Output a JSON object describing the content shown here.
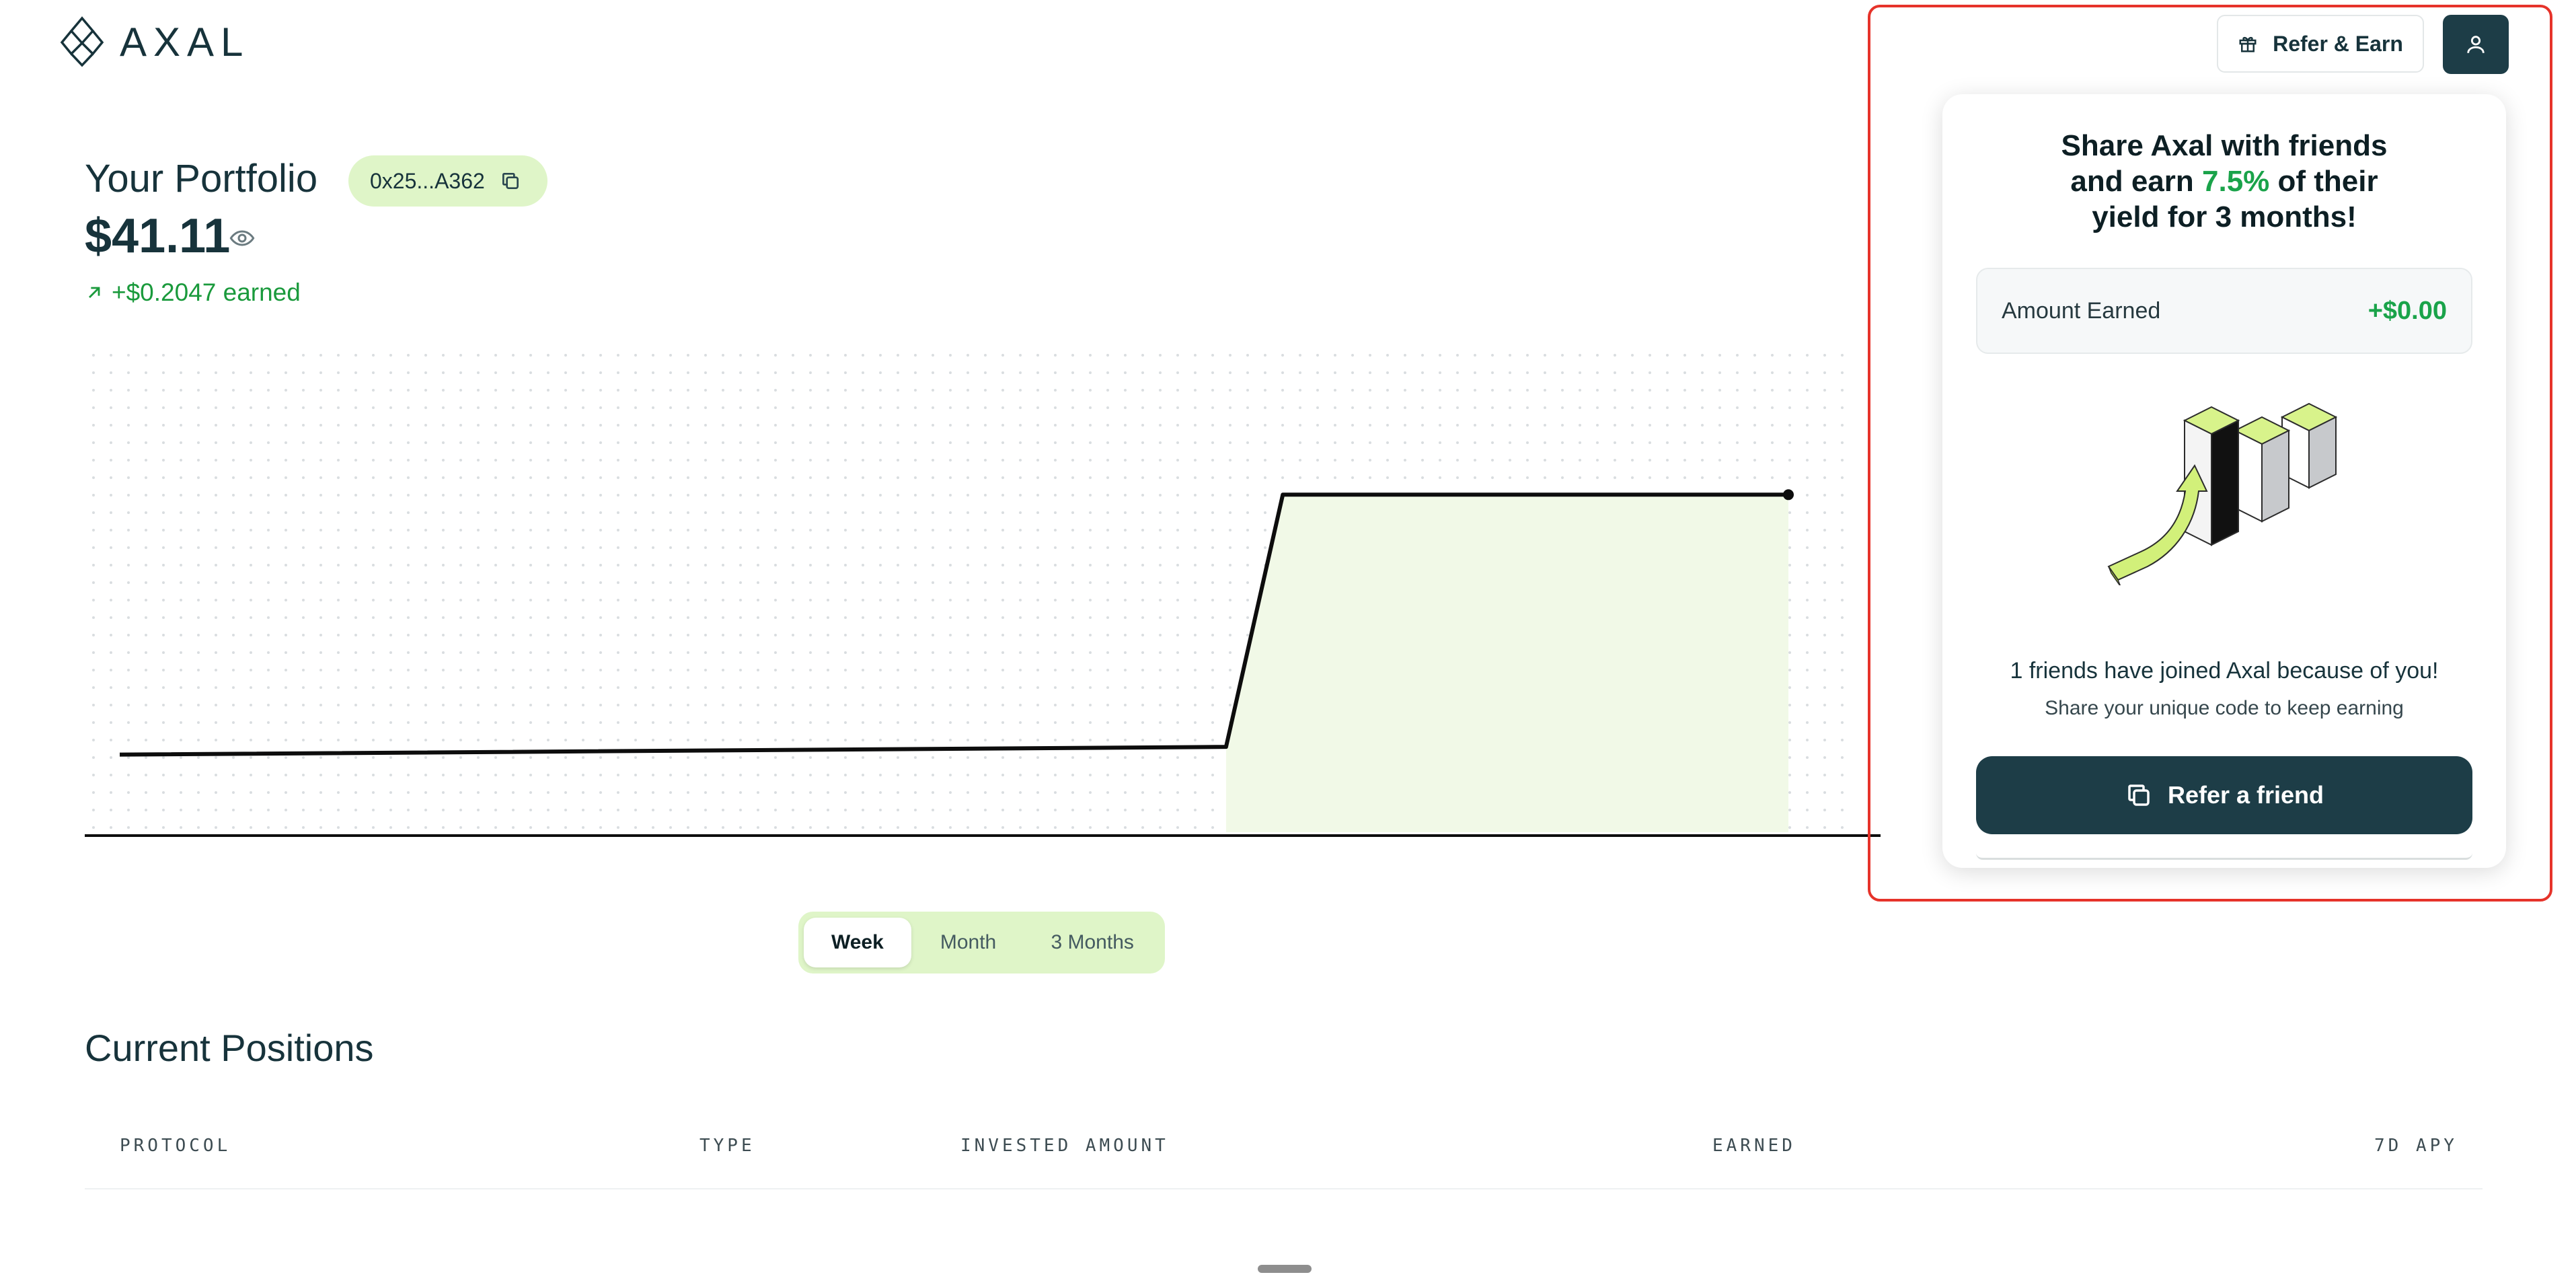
{
  "brand": {
    "name": "AXAL",
    "icon": "axal-logo-icon"
  },
  "portfolio": {
    "title": "Your Portfolio",
    "address": "0x25...A362",
    "balance": "$41.11",
    "earned": "+$0.2047 earned"
  },
  "chart_data": {
    "type": "area",
    "title": "",
    "xlabel": "",
    "ylabel": "",
    "grid": "dotted",
    "series": [
      {
        "values": [
          {
            "x": 0.0,
            "y": 0.0
          },
          {
            "x": 0.663,
            "y": 0.02
          },
          {
            "x": 0.697,
            "y": 0.67
          },
          {
            "x": 1.0,
            "y": 0.67
          }
        ]
      }
    ],
    "xlim": [
      0,
      1
    ],
    "ylim": [
      -0.2,
      1.0
    ],
    "shaded_from_x": 0.663,
    "line_color": "#0d0d0d",
    "fill_color": "#f1f9e7"
  },
  "range": {
    "options": [
      "Week",
      "Month",
      "3 Months"
    ],
    "selected": "Week"
  },
  "positions": {
    "title": "Current Positions",
    "columns": [
      "PROTOCOL",
      "TYPE",
      "INVESTED AMOUNT",
      "EARNED",
      "7D APY"
    ]
  },
  "header": {
    "refer_label": "Refer & Earn",
    "refer_icon": "gift-icon",
    "user_icon": "user-icon"
  },
  "referral_popover": {
    "heading_line1": "Share Axal with friends",
    "heading_line2_pre": "and earn ",
    "heading_accent": "7.5%",
    "heading_line2_post": " of their",
    "heading_line3": "yield for 3 months!",
    "amount_label": "Amount Earned",
    "amount_value": "+$0.00",
    "friends_text": "1 friends have joined Axal because of you!",
    "friends_sub": "Share your unique code to keep earning",
    "cta_label": "Refer a friend",
    "cta_icon": "copy-icon"
  },
  "colors": {
    "primary": "#1d3d47",
    "accent_green": "#1aa34a",
    "chip_green": "#dff5c8",
    "highlight_red": "#e6332a"
  }
}
